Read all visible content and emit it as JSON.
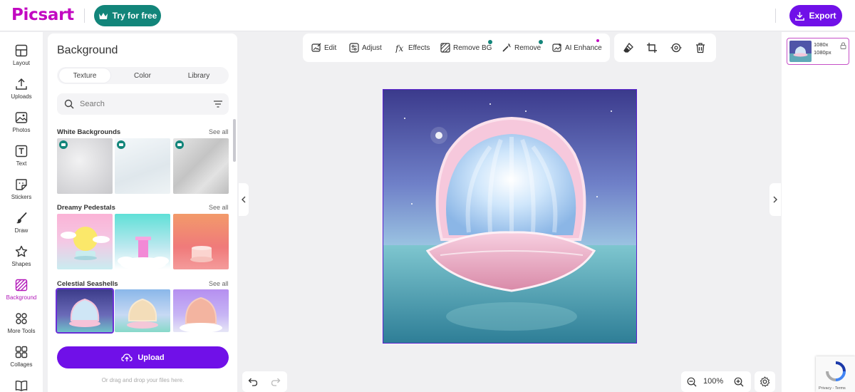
{
  "app": {
    "logo": "Picsart",
    "try_label": "Try for free",
    "export_label": "Export"
  },
  "rail": {
    "items": [
      {
        "label": "Layout",
        "icon": "layout-icon"
      },
      {
        "label": "Uploads",
        "icon": "upload-icon"
      },
      {
        "label": "Photos",
        "icon": "photo-icon"
      },
      {
        "label": "Text",
        "icon": "text-icon"
      },
      {
        "label": "Stickers",
        "icon": "sticker-icon"
      },
      {
        "label": "Draw",
        "icon": "brush-icon"
      },
      {
        "label": "Shapes",
        "icon": "star-icon"
      },
      {
        "label": "Background",
        "icon": "background-icon",
        "active": true
      },
      {
        "label": "More Tools",
        "icon": "grid-icon"
      },
      {
        "label": "Collages",
        "icon": "collage-icon"
      }
    ]
  },
  "panel": {
    "title": "Background",
    "tabs": [
      "Texture",
      "Color",
      "Library"
    ],
    "active_tab": "Texture",
    "search_placeholder": "Search",
    "sections": [
      {
        "title": "White Backgrounds",
        "see_all": "See all"
      },
      {
        "title": "Dreamy Pedestals",
        "see_all": "See all"
      },
      {
        "title": "Celestial Seashells",
        "see_all": "See all"
      }
    ],
    "upload_label": "Upload",
    "drag_hint": "Or drag and drop your files here."
  },
  "toolbar": {
    "tools": [
      "Edit",
      "Adjust",
      "Effects",
      "Remove BG",
      "Remove",
      "AI Enhance"
    ],
    "icon_tools": [
      "eraser-icon",
      "crop-icon",
      "replace-icon",
      "trash-icon"
    ]
  },
  "layers": {
    "size_line1": "1080x",
    "size_line2": "1080px"
  },
  "zoom": {
    "value": "100%"
  },
  "recaptcha": {
    "links": "Privacy - Terms"
  },
  "colors": {
    "brand": "#c209c1",
    "accent_purple": "#7010e8",
    "teal": "#12857a"
  }
}
